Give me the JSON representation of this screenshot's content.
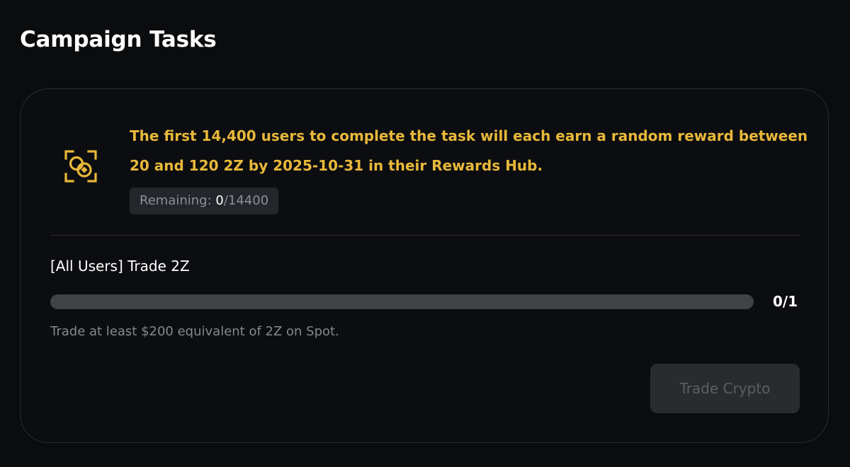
{
  "page": {
    "title": "Campaign Tasks"
  },
  "reward_info": {
    "icon": "reward-target-icon",
    "text": "The first 14,400 users to complete the task will each earn a random reward between 20 and 120 2Z by 2025-10-31 in their Rewards Hub.",
    "remaining_label": "Remaining: ",
    "remaining_current": "0",
    "remaining_total": "/14400"
  },
  "task": {
    "title": "[All Users] Trade 2Z",
    "progress_fraction": 0,
    "progress_text": "0/1",
    "description": "Trade at least $200 equivalent of 2Z on Spot.",
    "button_label": "Trade Crypto",
    "button_disabled": true
  },
  "colors": {
    "background": "#0b0c0e",
    "accent": "#e8b83a",
    "card_border": "#2a2c30",
    "progress_track": "#414245",
    "muted_text": "#85888f",
    "button_bg_disabled": "#2a2b2e"
  }
}
